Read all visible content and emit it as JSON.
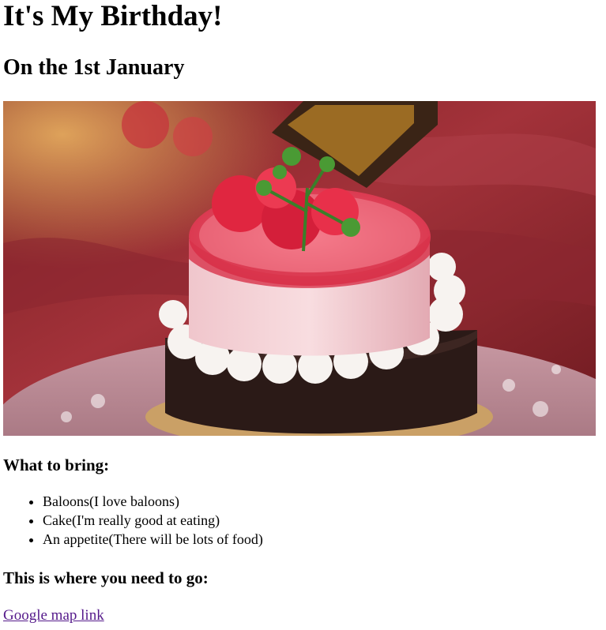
{
  "page": {
    "title": "It's My Birthday!",
    "subtitle": "On the 1st January"
  },
  "image": {
    "alt": "birthday cake"
  },
  "bring": {
    "heading": "What to bring:",
    "items": [
      "Baloons(I love baloons)",
      "Cake(I'm really good at eating)",
      "An appetite(There will be lots of food)"
    ]
  },
  "location": {
    "heading": "This is where you need to go:",
    "link_label": "Google map link"
  },
  "colors": {
    "link_visited": "#551a8b",
    "text": "#000000",
    "background": "#ffffff"
  }
}
